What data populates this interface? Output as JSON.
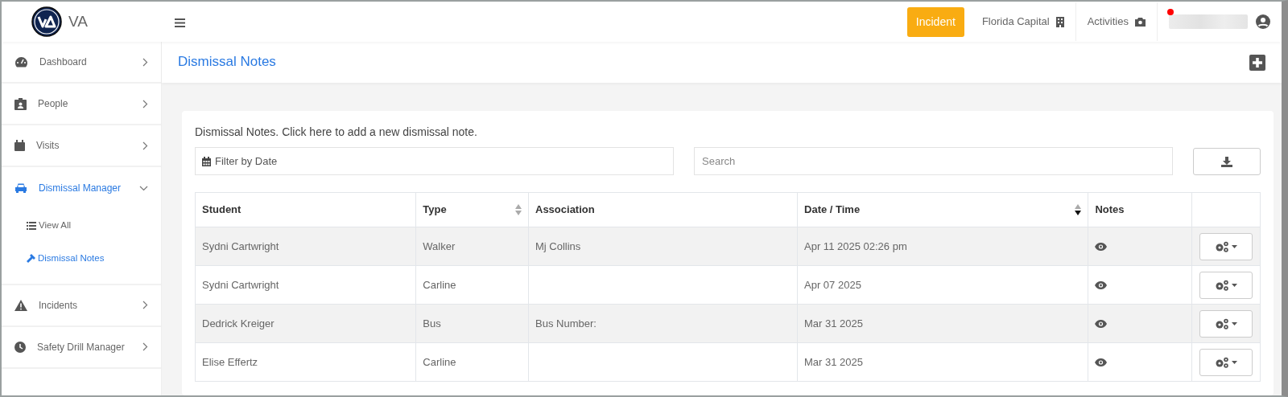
{
  "app": {
    "logo_text": "VA"
  },
  "topbar": {
    "incident_button": "Incident",
    "location": "Florida Capital",
    "activities": "Activities",
    "notification": true
  },
  "sidebar": {
    "items": [
      {
        "label": "Dashboard",
        "expanded": false,
        "selected": false
      },
      {
        "label": "People",
        "expanded": false,
        "selected": false
      },
      {
        "label": "Visits",
        "expanded": false,
        "selected": false
      },
      {
        "label": "Dismissal Manager",
        "expanded": true,
        "selected": true,
        "children": [
          {
            "label": "View All",
            "selected": false
          },
          {
            "label": "Dismissal Notes",
            "selected": true
          }
        ]
      },
      {
        "label": "Incidents",
        "expanded": false,
        "selected": false
      },
      {
        "label": "Safety Drill Manager",
        "expanded": false,
        "selected": false
      }
    ]
  },
  "page": {
    "title": "Dismissal Notes"
  },
  "card": {
    "intro": "Dismissal Notes. Click here to add a new dismissal note.",
    "date_filter": {
      "placeholder": "Filter by Date"
    },
    "search": {
      "placeholder": "Search"
    }
  },
  "table": {
    "columns": [
      {
        "label": "Student"
      },
      {
        "label": "Type",
        "sortable": true,
        "sorted": false
      },
      {
        "label": "Association"
      },
      {
        "label": "Date / Time",
        "sortable": true,
        "sorted": true
      },
      {
        "label": "Notes"
      }
    ],
    "rows": [
      {
        "student": "Sydni Cartwright",
        "type": "Walker",
        "association": "Mj Collins",
        "date_time": "Apr 11 2025 02:26 pm"
      },
      {
        "student": "Sydni Cartwright",
        "type": "Carline",
        "date_time": "Apr 07 2025"
      },
      {
        "student": "Dedrick Kreiger",
        "type": "Bus",
        "association": "Bus Number:",
        "date_time": "Mar 31 2025"
      },
      {
        "student": "Elise Effertz",
        "type": "Carline",
        "date_time": "Mar 31 2025"
      }
    ]
  }
}
